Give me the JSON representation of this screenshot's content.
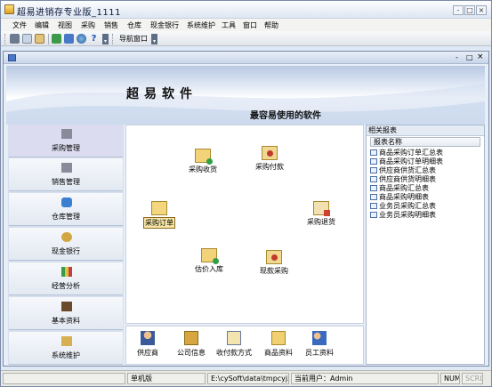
{
  "app": {
    "title": "超易进销存专业版_1111",
    "win_min": "-",
    "win_max": "□",
    "win_close": "×"
  },
  "menu": [
    "文件",
    "编辑",
    "视图",
    "采购",
    "销售",
    "仓库",
    "现金银行",
    "系统维护",
    "工具",
    "窗口",
    "帮助"
  ],
  "toolbar": {
    "nav_window": "导航窗口"
  },
  "child_window": {
    "min": "-",
    "max": "□",
    "close": "×"
  },
  "banner": {
    "brand": "超易软件",
    "slogan": "最容易使用的软件"
  },
  "sidebar": {
    "items": [
      {
        "label": "采购管理",
        "icon": "purchase-icon"
      },
      {
        "label": "销售管理",
        "icon": "sales-icon"
      },
      {
        "label": "仓库管理",
        "icon": "warehouse-icon"
      },
      {
        "label": "现金银行",
        "icon": "bank-icon"
      },
      {
        "label": "经营分析",
        "icon": "chart-icon"
      },
      {
        "label": "基本资料",
        "icon": "book-icon"
      },
      {
        "label": "系统维护",
        "icon": "tools-icon"
      }
    ]
  },
  "flow": {
    "purchase_receipt": "采购收货",
    "purchase_payment": "采购付款",
    "purchase_order": "采购订单",
    "purchase_return": "采购退货",
    "estimate_stockin": "估价入库",
    "cash_purchase": "现款采购"
  },
  "bottom": [
    "供应商",
    "公司信息",
    "收付款方式",
    "商品资料",
    "员工资料"
  ],
  "reports": {
    "title": "相关报表",
    "column": "报表名称",
    "items": [
      "商品采购订单汇总表",
      "商品采购订单明细表",
      "供应商供货汇总表",
      "供应商供货明细表",
      "商品采购汇总表",
      "商品采购明细表",
      "业务员采购汇总表",
      "业务员采购明细表"
    ]
  },
  "status": {
    "mode": "单机版",
    "path": "E:\\cySoft\\data\\tmpcyjxc.sys",
    "user": "当前用户：Admin",
    "num": "NUM",
    "scrl": "SCRL"
  },
  "colors": {
    "accent": "#dcdcf0",
    "frame": "#7a8aa6",
    "sidebar": "#d5dfed"
  }
}
